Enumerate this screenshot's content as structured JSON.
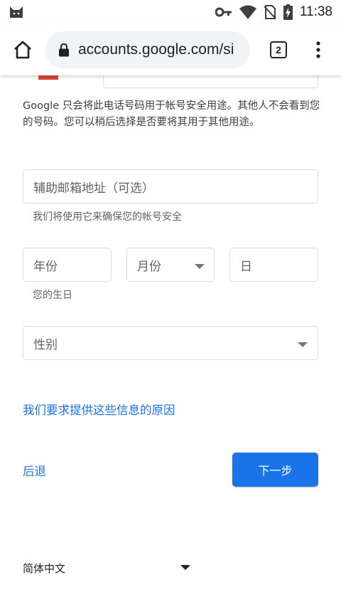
{
  "status_bar": {
    "time": "11:38",
    "icons": [
      "cat-icon",
      "key-icon",
      "wifi-icon",
      "no-sim-icon",
      "battery-icon"
    ]
  },
  "browser": {
    "url": "accounts.google.com/si",
    "tab_count": "2",
    "icons": [
      "home-icon",
      "lock-icon",
      "more-vert-icon"
    ]
  },
  "form": {
    "phone_help": "Google 只会将此电话号码用于帐号安全用途。其他人不会看到您的号码。您可以稍后选择是否要将其用于其他用途。",
    "recovery_email_placeholder": "辅助邮箱地址（可选）",
    "recovery_email_hint": "我们将使用它来确保您的帐号安全",
    "year_placeholder": "年份",
    "month_placeholder": "月份",
    "day_placeholder": "日",
    "birthday_hint": "您的生日",
    "gender_placeholder": "性别",
    "why_link": "我们要求提供这些信息的原因",
    "back_label": "后退",
    "next_label": "下一步"
  },
  "footer": {
    "language": "简体中文"
  },
  "colors": {
    "accent": "#1a73e8",
    "border": "#dadce0",
    "flag_red": "#db4437"
  }
}
